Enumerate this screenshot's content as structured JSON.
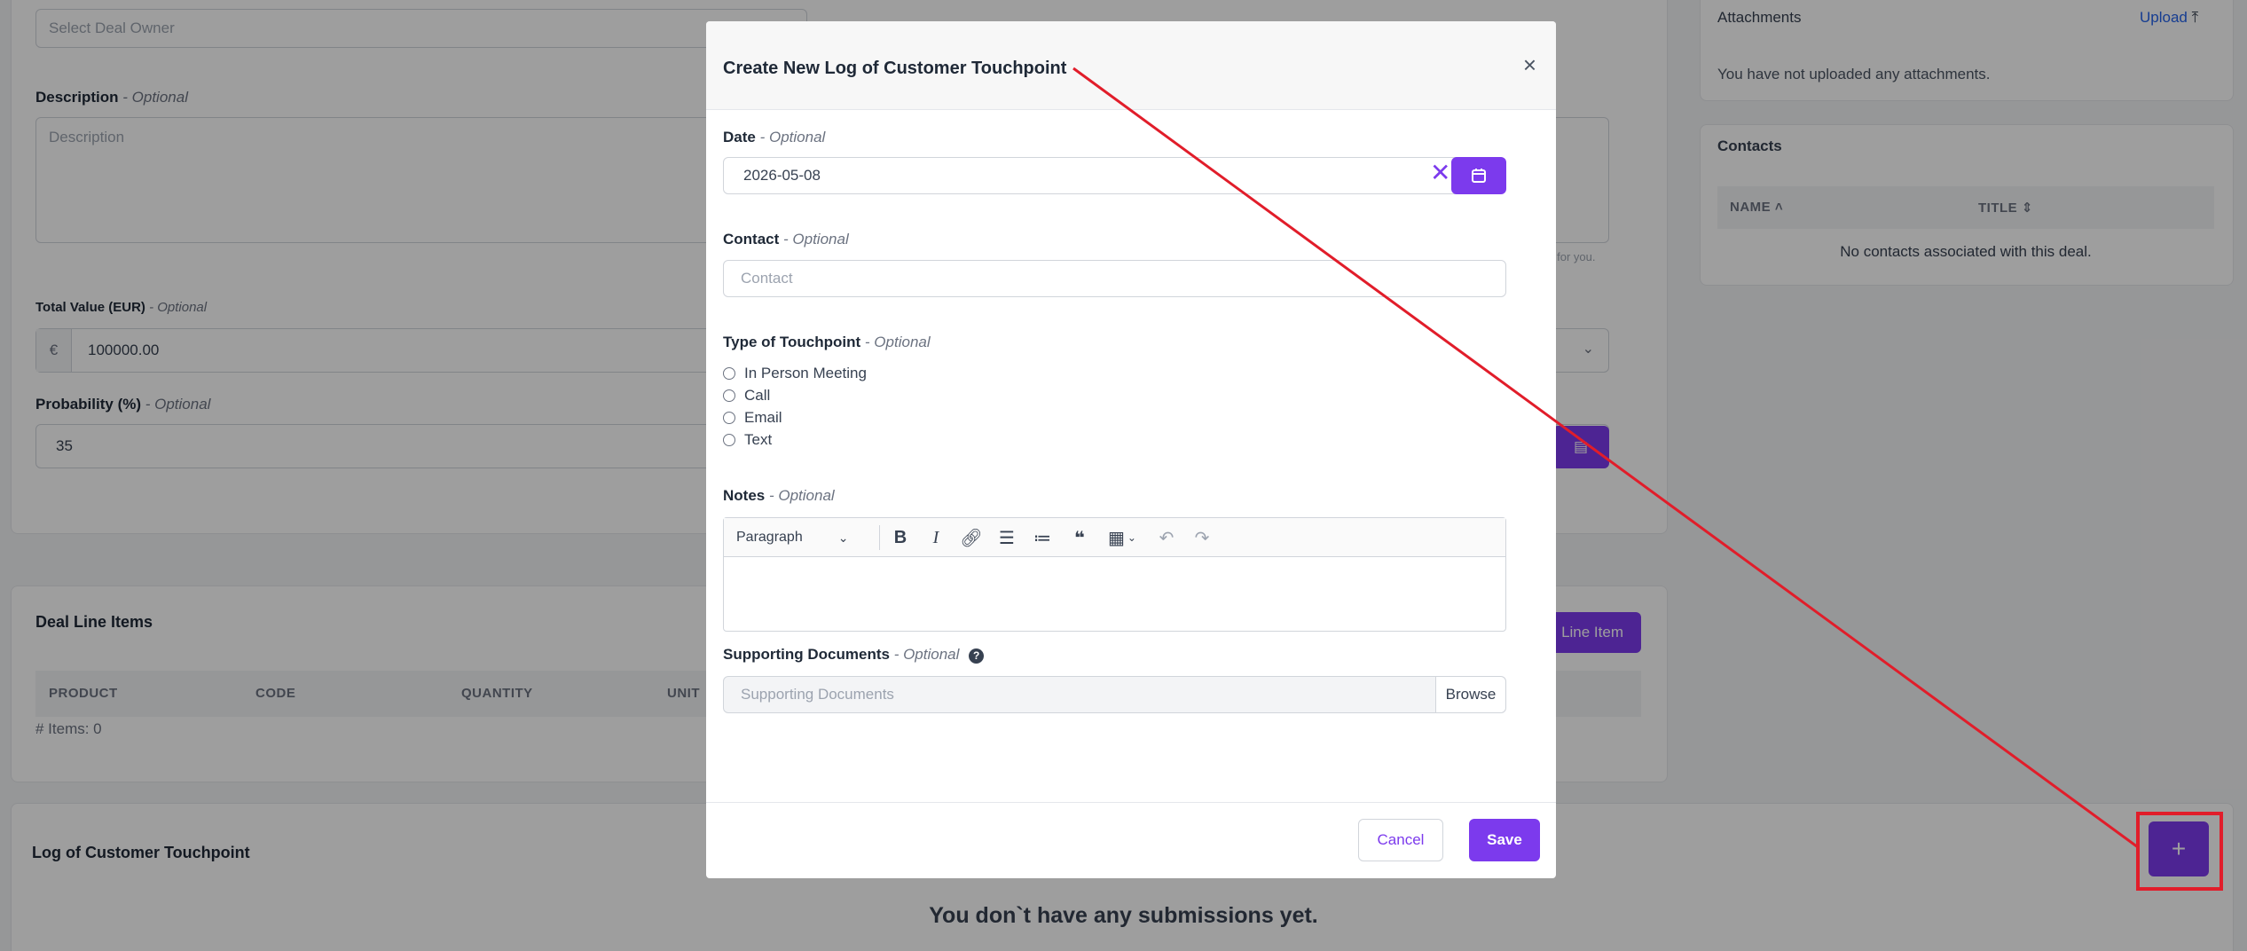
{
  "background": {
    "deal_owner_placeholder": "Select Deal Owner",
    "description_label": "Description",
    "description_optional": "- Optional",
    "description_placeholder": "Description",
    "total_value_label": "Total Value (EUR)",
    "total_value_optional": "- Optional",
    "currency_symbol": "€",
    "total_value": "100000.00",
    "probability_label": "Probability (%)",
    "probability_optional": "- Optional",
    "probability_value": "35",
    "hint_fragment": "it for you.",
    "attachments_title": "Attachments",
    "upload_label": "Upload",
    "no_attachments": "You have not uploaded any attachments.",
    "contacts_title": "Contacts",
    "contacts_columns": [
      "NAME",
      "TITLE"
    ],
    "no_contacts": "No contacts associated with this deal.",
    "deal_line_items_title": "Deal Line Items",
    "add_line_item_label": "Line Item",
    "line_item_columns": [
      "PRODUCT",
      "CODE",
      "QUANTITY",
      "UNIT"
    ],
    "items_count": "# Items: 0",
    "log_title": "Log of Customer Touchpoint",
    "no_submissions": "You don`t have any submissions yet.",
    "add_button_label": "+"
  },
  "modal": {
    "title": "Create New Log of Customer Touchpoint",
    "close_label": "×",
    "date_label": "Date",
    "date_optional": "- Optional",
    "date_value": "2026-05-08",
    "clear_icon": "✕",
    "contact_label": "Contact",
    "contact_optional": "- Optional",
    "contact_placeholder": "Contact",
    "type_label": "Type of Touchpoint",
    "type_optional": "- Optional",
    "type_options": [
      "In Person Meeting",
      "Call",
      "Email",
      "Text"
    ],
    "notes_label": "Notes",
    "notes_optional": "- Optional",
    "paragraph_label": "Paragraph",
    "docs_label": "Supporting Documents",
    "docs_optional": "- Optional",
    "docs_placeholder": "Supporting Documents",
    "browse_label": "Browse",
    "cancel_label": "Cancel",
    "save_label": "Save"
  },
  "colors": {
    "accent": "#7c3aed",
    "annotation": "#e11d2a"
  }
}
